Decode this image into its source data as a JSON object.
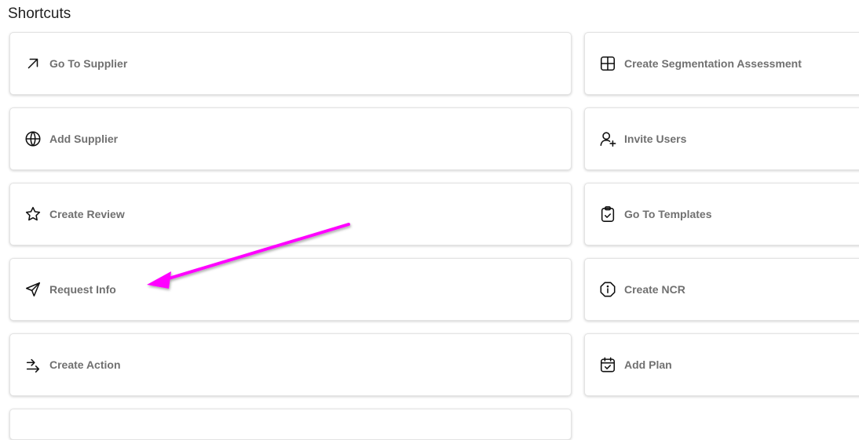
{
  "header": {
    "title": "Shortcuts"
  },
  "shortcuts": {
    "left": [
      {
        "label": "Go To Supplier",
        "icon": "arrow-up-right-icon"
      },
      {
        "label": "Add Supplier",
        "icon": "globe-icon"
      },
      {
        "label": "Create Review",
        "icon": "star-icon"
      },
      {
        "label": "Request Info",
        "icon": "send-icon"
      },
      {
        "label": "Create Action",
        "icon": "arrows-right-icon"
      }
    ],
    "right": [
      {
        "label": "Create Segmentation Assessment",
        "icon": "grid-icon"
      },
      {
        "label": "Invite Users",
        "icon": "user-plus-icon"
      },
      {
        "label": "Go To Templates",
        "icon": "clipboard-check-icon"
      },
      {
        "label": "Create NCR",
        "icon": "octagon-info-icon"
      },
      {
        "label": "Add Plan",
        "icon": "calendar-check-icon"
      }
    ]
  },
  "annotation": {
    "color": "#ff00ff",
    "icon": "annotation-arrow"
  }
}
